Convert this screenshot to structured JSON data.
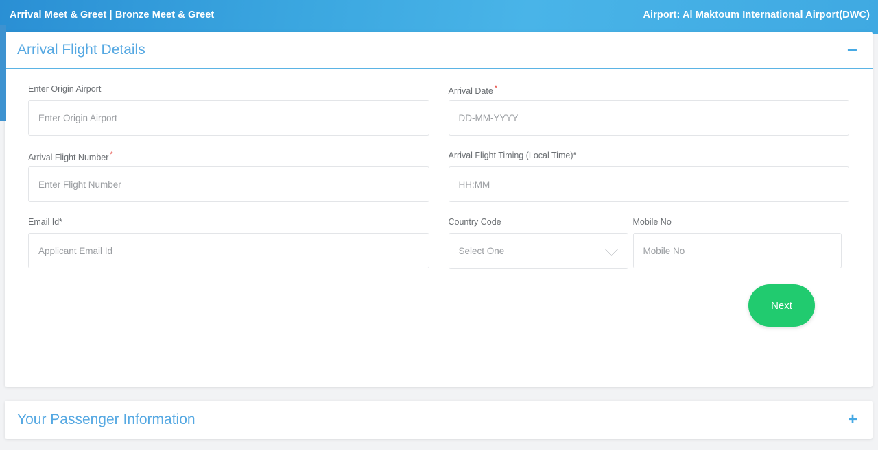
{
  "topbar": {
    "title": "Arrival Meet & Greet | Bronze Meet & Greet",
    "airport": "Airport: Al Maktoum International Airport(DWC)",
    "accent_color": "#3ba7e0"
  },
  "flight_section": {
    "title": "Arrival Flight Details",
    "toggle_icon": "minus-icon",
    "toggle_glyph": "−",
    "accent_color": "#55a8e2",
    "fields": {
      "origin_airport": {
        "label": "Enter Origin Airport",
        "placeholder": "Enter Origin Airport",
        "required": false,
        "value": ""
      },
      "arrival_date": {
        "label": "Arrival Date",
        "required_mark": "*",
        "placeholder": "DD-MM-YYYY",
        "required": true,
        "value": ""
      },
      "flight_number": {
        "label": "Arrival Flight Number",
        "required_mark": "*",
        "placeholder": "Enter Flight Number",
        "required": true,
        "value": ""
      },
      "flight_timing": {
        "label": "Arrival Flight Timing (Local Time)*",
        "placeholder": "HH:MM",
        "required": true,
        "value": ""
      },
      "email_id": {
        "label": "Email Id*",
        "placeholder": "Applicant Email Id",
        "required": true,
        "value": ""
      },
      "country_code": {
        "label": "Country Code",
        "selected": "Select One",
        "dropdown_icon": "chevron-down-icon",
        "required": false
      },
      "mobile_no": {
        "label": "Mobile No",
        "placeholder": "Mobile No",
        "required": false,
        "value": ""
      }
    },
    "next_button": {
      "label": "Next",
      "color": "#21cb6f"
    }
  },
  "passenger_section": {
    "title": "Your Passenger Information",
    "toggle_icon": "plus-icon",
    "toggle_glyph": "+"
  }
}
